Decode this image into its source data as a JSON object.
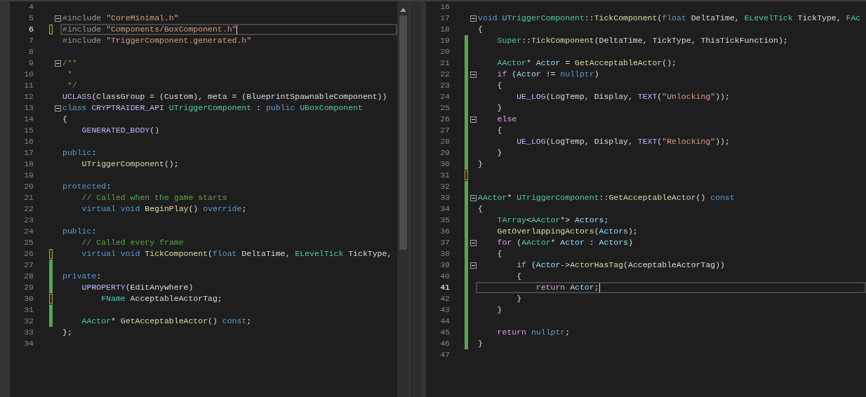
{
  "editors": [
    {
      "lines": [
        {
          "number": "4",
          "saved_change": false,
          "unsaved_change": false,
          "fold": false,
          "current": false
        },
        {
          "number": "5",
          "saved_change": false,
          "unsaved_change": false,
          "fold": true,
          "current": false,
          "tokens": [
            {
              "text": "#include ",
              "kind": "preproc"
            },
            {
              "text": "\"CoreMinimal.h\"",
              "kind": "string"
            }
          ]
        },
        {
          "number": "6",
          "saved_change": false,
          "unsaved_change": true,
          "fold": false,
          "current": true,
          "tokens": [
            {
              "text": "#include ",
              "kind": "preproc"
            },
            {
              "text": "\"Components/BoxComponent.h\"",
              "kind": "string"
            }
          ]
        },
        {
          "number": "7",
          "saved_change": false,
          "unsaved_change": false,
          "fold": false,
          "current": false,
          "tokens": [
            {
              "text": "#include ",
              "kind": "preproc"
            },
            {
              "text": "\"TriggerComponent.generated.h\"",
              "kind": "string"
            }
          ]
        },
        {
          "number": "8",
          "saved_change": false,
          "unsaved_change": false,
          "fold": false,
          "current": false
        },
        {
          "number": "9",
          "saved_change": false,
          "unsaved_change": false,
          "fold": true,
          "current": false,
          "tokens": [
            {
              "text": "/**",
              "kind": "comment"
            }
          ]
        },
        {
          "number": "10",
          "saved_change": false,
          "unsaved_change": false,
          "fold": false,
          "current": false,
          "tokens": [
            {
              "text": " *",
              "kind": "comment"
            }
          ]
        },
        {
          "number": "11",
          "saved_change": false,
          "unsaved_change": false,
          "fold": false,
          "current": false,
          "tokens": [
            {
              "text": " */",
              "kind": "comment"
            }
          ]
        },
        {
          "number": "12",
          "saved_change": false,
          "unsaved_change": false,
          "fold": false,
          "current": false,
          "tokens": [
            {
              "text": "UCLASS",
              "kind": "macro"
            },
            {
              "text": "(ClassGroup = (Custom), meta = (BlueprintSpawnableComponent))",
              "kind": "plain"
            }
          ]
        },
        {
          "number": "13",
          "saved_change": false,
          "unsaved_change": false,
          "fold": true,
          "current": false,
          "tokens": [
            {
              "text": "class ",
              "kind": "keyword"
            },
            {
              "text": "CRYPTRAIDER_API ",
              "kind": "macro"
            },
            {
              "text": "UTriggerComponent",
              "kind": "type"
            },
            {
              "text": " : ",
              "kind": "plain"
            },
            {
              "text": "public ",
              "kind": "keyword"
            },
            {
              "text": "UBoxComponent",
              "kind": "type"
            }
          ]
        },
        {
          "number": "14",
          "saved_change": false,
          "unsaved_change": false,
          "fold": false,
          "current": false,
          "tokens": [
            {
              "text": "{",
              "kind": "plain"
            }
          ]
        },
        {
          "number": "15",
          "saved_change": false,
          "unsaved_change": false,
          "fold": false,
          "current": false,
          "tokens": [
            {
              "text": "    GENERATED_BODY",
              "kind": "macro"
            },
            {
              "text": "()",
              "kind": "plain"
            }
          ]
        },
        {
          "number": "16",
          "saved_change": false,
          "unsaved_change": false,
          "fold": false,
          "current": false
        },
        {
          "number": "17",
          "saved_change": false,
          "unsaved_change": false,
          "fold": false,
          "current": false,
          "tokens": [
            {
              "text": "public",
              "kind": "keyword"
            },
            {
              "text": ":",
              "kind": "plain"
            }
          ]
        },
        {
          "number": "18",
          "saved_change": false,
          "unsaved_change": false,
          "fold": false,
          "current": false,
          "tokens": [
            {
              "text": "    UTriggerComponent",
              "kind": "function"
            },
            {
              "text": "();",
              "kind": "plain"
            }
          ]
        },
        {
          "number": "19",
          "saved_change": false,
          "unsaved_change": false,
          "fold": false,
          "current": false
        },
        {
          "number": "20",
          "saved_change": false,
          "unsaved_change": false,
          "fold": false,
          "current": false,
          "tokens": [
            {
              "text": "protected",
              "kind": "keyword"
            },
            {
              "text": ":",
              "kind": "plain"
            }
          ]
        },
        {
          "number": "21",
          "saved_change": false,
          "unsaved_change": false,
          "fold": false,
          "current": false,
          "tokens": [
            {
              "text": "    // Called when the game starts",
              "kind": "comment"
            }
          ]
        },
        {
          "number": "22",
          "saved_change": false,
          "unsaved_change": false,
          "fold": false,
          "current": false,
          "tokens": [
            {
              "text": "    virtual void ",
              "kind": "keyword"
            },
            {
              "text": "BeginPlay",
              "kind": "function"
            },
            {
              "text": "() ",
              "kind": "plain"
            },
            {
              "text": "override",
              "kind": "keyword"
            },
            {
              "text": ";",
              "kind": "plain"
            }
          ]
        },
        {
          "number": "23",
          "saved_change": false,
          "unsaved_change": false,
          "fold": false,
          "current": false
        },
        {
          "number": "24",
          "saved_change": false,
          "unsaved_change": false,
          "fold": false,
          "current": false,
          "tokens": [
            {
              "text": "public",
              "kind": "keyword"
            },
            {
              "text": ":",
              "kind": "plain"
            }
          ]
        },
        {
          "number": "25",
          "saved_change": false,
          "unsaved_change": false,
          "fold": false,
          "current": false,
          "tokens": [
            {
              "text": "    // Called every frame",
              "kind": "comment"
            }
          ]
        },
        {
          "number": "26",
          "saved_change": false,
          "unsaved_change": true,
          "fold": false,
          "current": false,
          "tokens": [
            {
              "text": "    virtual void ",
              "kind": "keyword"
            },
            {
              "text": "TickComponent",
              "kind": "function"
            },
            {
              "text": "(",
              "kind": "plain"
            },
            {
              "text": "float",
              "kind": "keyword"
            },
            {
              "text": " DeltaTime, ",
              "kind": "plain"
            },
            {
              "text": "ELevelTick",
              "kind": "type"
            },
            {
              "text": " TickType,",
              "kind": "plain"
            }
          ]
        },
        {
          "number": "27",
          "saved_change": true,
          "unsaved_change": false,
          "fold": false,
          "current": false
        },
        {
          "number": "28",
          "saved_change": true,
          "unsaved_change": false,
          "fold": false,
          "current": false,
          "tokens": [
            {
              "text": "private",
              "kind": "keyword"
            },
            {
              "text": ":",
              "kind": "plain"
            }
          ]
        },
        {
          "number": "29",
          "saved_change": true,
          "unsaved_change": false,
          "fold": false,
          "current": false,
          "tokens": [
            {
              "text": "    UPROPERTY",
              "kind": "macro"
            },
            {
              "text": "(EditAnywhere)",
              "kind": "plain"
            }
          ]
        },
        {
          "number": "30",
          "saved_change": false,
          "unsaved_change": true,
          "fold": false,
          "current": false,
          "tokens": [
            {
              "text": "        FName",
              "kind": "type"
            },
            {
              "text": " AcceptableActorTag;",
              "kind": "plain"
            }
          ]
        },
        {
          "number": "31",
          "saved_change": true,
          "unsaved_change": false,
          "fold": false,
          "current": false
        },
        {
          "number": "32",
          "saved_change": true,
          "unsaved_change": false,
          "fold": false,
          "current": false,
          "tokens": [
            {
              "text": "    AActor",
              "kind": "type"
            },
            {
              "text": "* ",
              "kind": "plain"
            },
            {
              "text": "GetAcceptableActor",
              "kind": "function"
            },
            {
              "text": "() ",
              "kind": "plain"
            },
            {
              "text": "const",
              "kind": "keyword"
            },
            {
              "text": ";",
              "kind": "plain"
            }
          ]
        },
        {
          "number": "33",
          "saved_change": false,
          "unsaved_change": false,
          "fold": false,
          "current": false,
          "tokens": [
            {
              "text": "};",
              "kind": "plain"
            }
          ]
        },
        {
          "number": "34",
          "saved_change": false,
          "unsaved_change": false,
          "fold": false,
          "current": false
        }
      ]
    },
    {
      "lines": [
        {
          "number": "16",
          "saved_change": false,
          "unsaved_change": false,
          "fold": false,
          "current": false
        },
        {
          "number": "17",
          "saved_change": false,
          "unsaved_change": false,
          "fold": true,
          "current": false,
          "tokens": [
            {
              "text": "void ",
              "kind": "keyword"
            },
            {
              "text": "UTriggerComponent",
              "kind": "type"
            },
            {
              "text": "::",
              "kind": "plain"
            },
            {
              "text": "TickComponent",
              "kind": "function"
            },
            {
              "text": "(",
              "kind": "plain"
            },
            {
              "text": "float",
              "kind": "keyword"
            },
            {
              "text": " DeltaTime, ",
              "kind": "plain"
            },
            {
              "text": "ELevelTick",
              "kind": "type"
            },
            {
              "text": " TickType, ",
              "kind": "plain"
            },
            {
              "text": "FAc",
              "kind": "type"
            }
          ]
        },
        {
          "number": "18",
          "saved_change": false,
          "unsaved_change": false,
          "fold": false,
          "current": false,
          "tokens": [
            {
              "text": "{",
              "kind": "plain"
            }
          ]
        },
        {
          "number": "19",
          "saved_change": true,
          "unsaved_change": false,
          "fold": false,
          "current": false,
          "tokens": [
            {
              "text": "    Super",
              "kind": "type"
            },
            {
              "text": "::",
              "kind": "plain"
            },
            {
              "text": "TickComponent",
              "kind": "function"
            },
            {
              "text": "(DeltaTime, TickType, ThisTickFunction);",
              "kind": "plain"
            }
          ]
        },
        {
          "number": "20",
          "saved_change": true,
          "unsaved_change": false,
          "fold": false,
          "current": false
        },
        {
          "number": "21",
          "saved_change": true,
          "unsaved_change": false,
          "fold": false,
          "current": false,
          "tokens": [
            {
              "text": "    AActor",
              "kind": "type"
            },
            {
              "text": "* ",
              "kind": "plain"
            },
            {
              "text": "Actor",
              "kind": "variable"
            },
            {
              "text": " = ",
              "kind": "plain"
            },
            {
              "text": "GetAcceptableActor",
              "kind": "function"
            },
            {
              "text": "();",
              "kind": "plain"
            }
          ]
        },
        {
          "number": "22",
          "saved_change": true,
          "unsaved_change": false,
          "fold": true,
          "current": false,
          "tokens": [
            {
              "text": "    if",
              "kind": "control"
            },
            {
              "text": " (",
              "kind": "plain"
            },
            {
              "text": "Actor",
              "kind": "variable"
            },
            {
              "text": " != ",
              "kind": "plain"
            },
            {
              "text": "nullptr",
              "kind": "keyword"
            },
            {
              "text": ")",
              "kind": "plain"
            }
          ]
        },
        {
          "number": "23",
          "saved_change": true,
          "unsaved_change": false,
          "fold": false,
          "current": false,
          "tokens": [
            {
              "text": "    {",
              "kind": "plain"
            }
          ]
        },
        {
          "number": "24",
          "saved_change": true,
          "unsaved_change": false,
          "fold": false,
          "current": false,
          "tokens": [
            {
              "text": "        UE_LOG",
              "kind": "macro"
            },
            {
              "text": "(LogTemp, Display, ",
              "kind": "plain"
            },
            {
              "text": "TEXT",
              "kind": "macro"
            },
            {
              "text": "(",
              "kind": "plain"
            },
            {
              "text": "\"Unlocking\"",
              "kind": "string"
            },
            {
              "text": "));",
              "kind": "plain"
            }
          ]
        },
        {
          "number": "25",
          "saved_change": true,
          "unsaved_change": false,
          "fold": false,
          "current": false,
          "tokens": [
            {
              "text": "    }",
              "kind": "plain"
            }
          ]
        },
        {
          "number": "26",
          "saved_change": true,
          "unsaved_change": false,
          "fold": true,
          "current": false,
          "tokens": [
            {
              "text": "    else",
              "kind": "control"
            }
          ]
        },
        {
          "number": "27",
          "saved_change": true,
          "unsaved_change": false,
          "fold": false,
          "current": false,
          "tokens": [
            {
              "text": "    {",
              "kind": "plain"
            }
          ]
        },
        {
          "number": "28",
          "saved_change": true,
          "unsaved_change": false,
          "fold": false,
          "current": false,
          "tokens": [
            {
              "text": "        UE_LOG",
              "kind": "macro"
            },
            {
              "text": "(LogTemp, Display, ",
              "kind": "plain"
            },
            {
              "text": "TEXT",
              "kind": "macro"
            },
            {
              "text": "(",
              "kind": "plain"
            },
            {
              "text": "\"Relocking\"",
              "kind": "string"
            },
            {
              "text": "));",
              "kind": "plain"
            }
          ]
        },
        {
          "number": "29",
          "saved_change": true,
          "unsaved_change": false,
          "fold": false,
          "current": false,
          "tokens": [
            {
              "text": "    }",
              "kind": "plain"
            }
          ]
        },
        {
          "number": "30",
          "saved_change": true,
          "unsaved_change": false,
          "fold": false,
          "current": false,
          "tokens": [
            {
              "text": "}",
              "kind": "plain"
            }
          ]
        },
        {
          "number": "31",
          "saved_change": false,
          "unsaved_change": true,
          "fold": false,
          "current": false
        },
        {
          "number": "32",
          "saved_change": true,
          "unsaved_change": false,
          "fold": false,
          "current": false
        },
        {
          "number": "33",
          "saved_change": true,
          "unsaved_change": false,
          "fold": true,
          "current": false,
          "tokens": [
            {
              "text": "AActor",
              "kind": "type"
            },
            {
              "text": "* ",
              "kind": "plain"
            },
            {
              "text": "UTriggerComponent",
              "kind": "type"
            },
            {
              "text": "::",
              "kind": "plain"
            },
            {
              "text": "GetAcceptableActor",
              "kind": "function"
            },
            {
              "text": "() ",
              "kind": "plain"
            },
            {
              "text": "const",
              "kind": "keyword"
            }
          ]
        },
        {
          "number": "34",
          "saved_change": true,
          "unsaved_change": false,
          "fold": false,
          "current": false,
          "tokens": [
            {
              "text": "{",
              "kind": "plain"
            }
          ]
        },
        {
          "number": "35",
          "saved_change": true,
          "unsaved_change": false,
          "fold": false,
          "current": false,
          "tokens": [
            {
              "text": "    TArray",
              "kind": "type"
            },
            {
              "text": "<",
              "kind": "plain"
            },
            {
              "text": "AActor",
              "kind": "type"
            },
            {
              "text": "*> ",
              "kind": "plain"
            },
            {
              "text": "Actors",
              "kind": "variable"
            },
            {
              "text": ";",
              "kind": "plain"
            }
          ]
        },
        {
          "number": "36",
          "saved_change": true,
          "unsaved_change": false,
          "fold": false,
          "current": false,
          "tokens": [
            {
              "text": "    GetOverlappingActors",
              "kind": "function"
            },
            {
              "text": "(",
              "kind": "plain"
            },
            {
              "text": "Actors",
              "kind": "variable"
            },
            {
              "text": ");",
              "kind": "plain"
            }
          ]
        },
        {
          "number": "37",
          "saved_change": true,
          "unsaved_change": false,
          "fold": true,
          "current": false,
          "tokens": [
            {
              "text": "    for",
              "kind": "control"
            },
            {
              "text": " (",
              "kind": "plain"
            },
            {
              "text": "AActor",
              "kind": "type"
            },
            {
              "text": "* ",
              "kind": "plain"
            },
            {
              "text": "Actor",
              "kind": "variable"
            },
            {
              "text": " : ",
              "kind": "plain"
            },
            {
              "text": "Actors",
              "kind": "variable"
            },
            {
              "text": ")",
              "kind": "plain"
            }
          ]
        },
        {
          "number": "38",
          "saved_change": true,
          "unsaved_change": false,
          "fold": false,
          "current": false,
          "tokens": [
            {
              "text": "    {",
              "kind": "plain"
            }
          ]
        },
        {
          "number": "39",
          "saved_change": true,
          "unsaved_change": false,
          "fold": true,
          "current": false,
          "tokens": [
            {
              "text": "        if",
              "kind": "control"
            },
            {
              "text": " (",
              "kind": "plain"
            },
            {
              "text": "Actor",
              "kind": "variable"
            },
            {
              "text": "->",
              "kind": "plain"
            },
            {
              "text": "ActorHasTag",
              "kind": "function"
            },
            {
              "text": "(AcceptableActorTag))",
              "kind": "plain"
            }
          ]
        },
        {
          "number": "40",
          "saved_change": true,
          "unsaved_change": false,
          "fold": false,
          "current": false,
          "tokens": [
            {
              "text": "        {",
              "kind": "plain"
            }
          ]
        },
        {
          "number": "41",
          "saved_change": true,
          "unsaved_change": false,
          "fold": false,
          "current": true,
          "tokens": [
            {
              "text": "            return ",
              "kind": "control"
            },
            {
              "text": "Actor",
              "kind": "variable"
            },
            {
              "text": ";",
              "kind": "plain"
            }
          ]
        },
        {
          "number": "42",
          "saved_change": true,
          "unsaved_change": false,
          "fold": false,
          "current": false,
          "tokens": [
            {
              "text": "        }",
              "kind": "plain"
            }
          ]
        },
        {
          "number": "43",
          "saved_change": true,
          "unsaved_change": false,
          "fold": false,
          "current": false,
          "tokens": [
            {
              "text": "    }",
              "kind": "plain"
            }
          ]
        },
        {
          "number": "44",
          "saved_change": true,
          "unsaved_change": false,
          "fold": false,
          "current": false
        },
        {
          "number": "45",
          "saved_change": true,
          "unsaved_change": false,
          "fold": false,
          "current": false,
          "tokens": [
            {
              "text": "    return ",
              "kind": "control"
            },
            {
              "text": "nullptr",
              "kind": "keyword"
            },
            {
              "text": ";",
              "kind": "plain"
            }
          ]
        },
        {
          "number": "46",
          "saved_change": true,
          "unsaved_change": false,
          "fold": false,
          "current": false,
          "tokens": [
            {
              "text": "}",
              "kind": "plain"
            }
          ]
        },
        {
          "number": "47",
          "saved_change": false,
          "unsaved_change": false,
          "fold": false,
          "current": false
        }
      ]
    }
  ]
}
